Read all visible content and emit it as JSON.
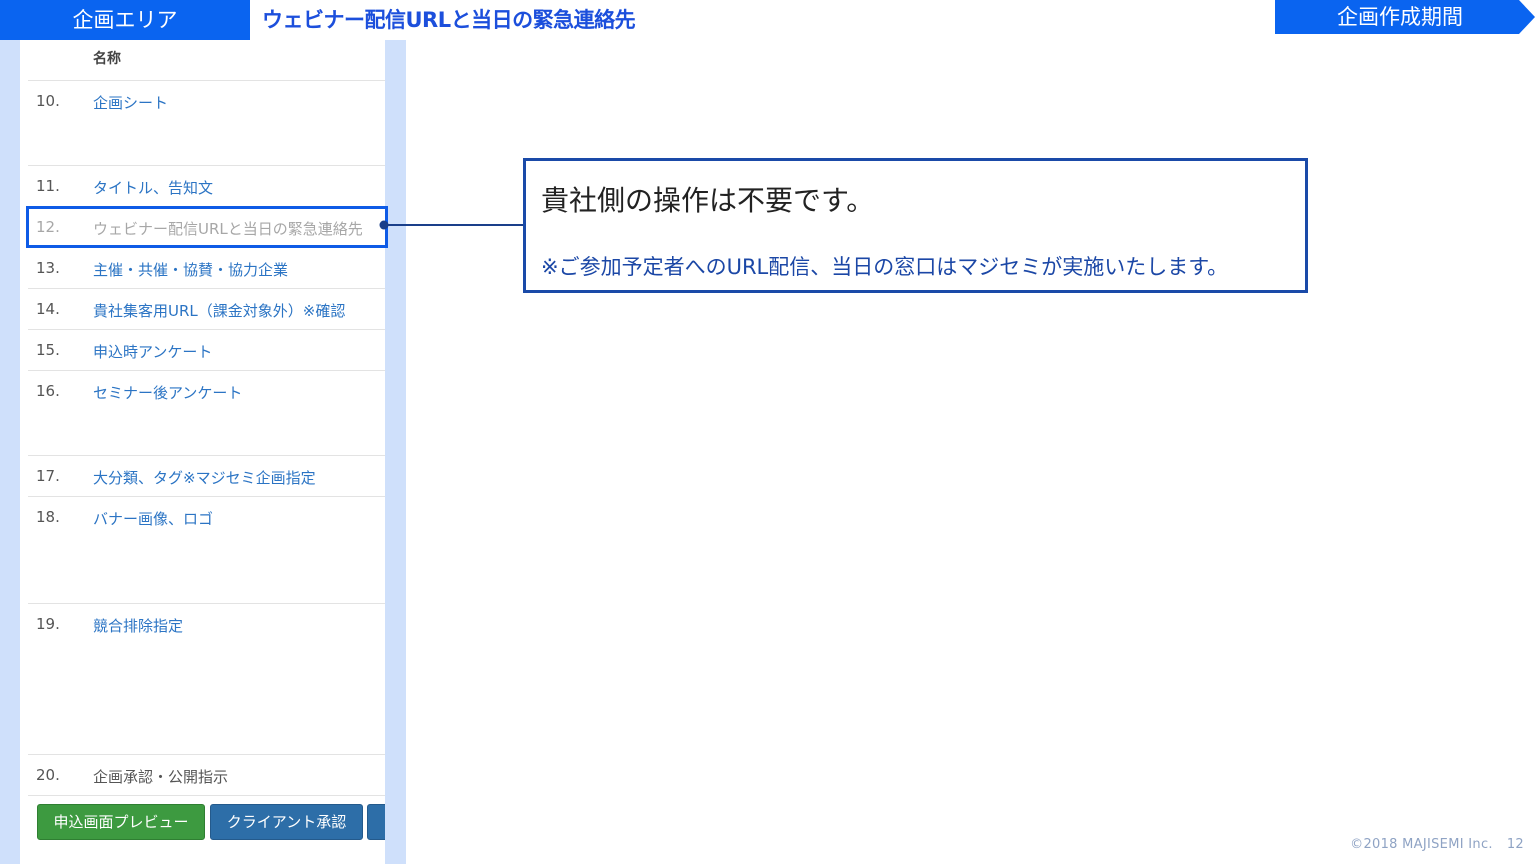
{
  "header": {
    "area_label": "企画エリア",
    "title": "ウェビナー配信URLと当日の緊急連絡先",
    "period_label": "企画作成期間",
    "accent_color": "#0a64f0"
  },
  "table": {
    "column_header": "名称",
    "rows": [
      {
        "num": "10.",
        "name": "企画シート"
      },
      {
        "num": "11.",
        "name": "タイトル、告知文"
      },
      {
        "num": "12.",
        "name": "ウェビナー配信URLと当日の緊急連絡先"
      },
      {
        "num": "13.",
        "name": "主催・共催・協賛・協力企業"
      },
      {
        "num": "14.",
        "name": "貴社集客用URL（課金対象外）※確認"
      },
      {
        "num": "15.",
        "name": "申込時アンケート"
      },
      {
        "num": "16.",
        "name": "セミナー後アンケート"
      },
      {
        "num": "17.",
        "name": "大分類、タグ※マジセミ企画指定"
      },
      {
        "num": "18.",
        "name": "バナー画像、ロゴ"
      },
      {
        "num": "19.",
        "name": "競合排除指定"
      },
      {
        "num": "20.",
        "name": "企画承認・公開指示"
      }
    ],
    "selected_row": "12."
  },
  "buttons": {
    "preview": "申込画面プレビュー",
    "client_approval": "クライアント承認"
  },
  "callout": {
    "heading": "貴社側の操作は不要です。",
    "note": "※ご参加予定者へのURL配信、当日の窓口はマジセミが実施いたします。"
  },
  "footer": {
    "copyright": "©2018 MAJISEMI Inc.",
    "page": "12"
  }
}
